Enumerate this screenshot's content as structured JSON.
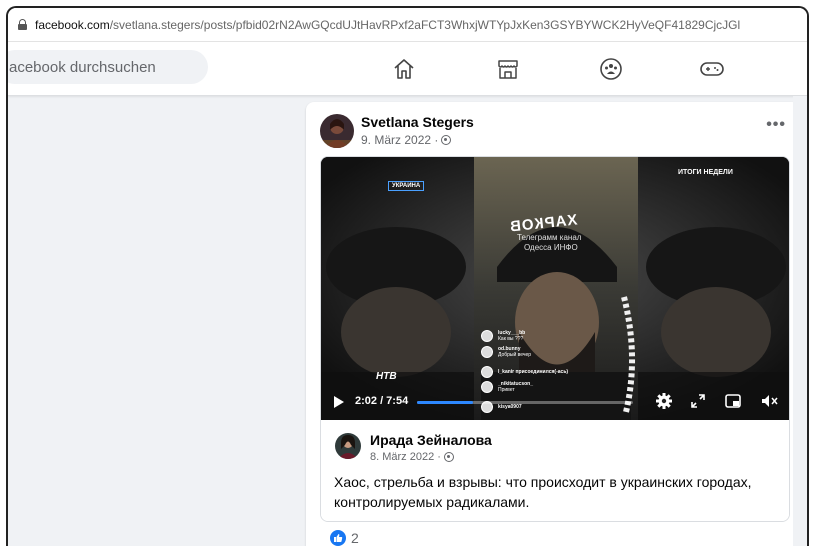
{
  "browser": {
    "url_domain": "facebook.com",
    "url_path": "/svetlana.stegers/posts/pfbid02rN2AwGQcdUJtHavRPxf2aFCT3WhxjWTYpJxKen3GSYBYWCK2HyVeQF41829CjcJGl"
  },
  "nav": {
    "search_placeholder": "acebook durchsuchen",
    "icons": [
      "home-icon",
      "marketplace-icon",
      "groups-icon",
      "gaming-icon"
    ]
  },
  "post": {
    "author": "Svetlana Stegers",
    "date": "9. März 2022 ·",
    "more_label": "•••",
    "video": {
      "tag_left": "УКРАИНА",
      "tag_right": "ИТОГИ НЕДЕЛИ",
      "hat_text": "ХАРКОВ",
      "overlay_line1": "Телеграмм канал",
      "overlay_line2": "Одесса ИНФО",
      "channel_logo": "НТВ",
      "time_display": "2:02 / 7:54",
      "progress": 0.26,
      "chat": [
        {
          "user": "lucky___bb",
          "msg": "Как вы ???"
        },
        {
          "user": "od.bunny",
          "msg": "Добрый вечер"
        },
        {
          "user": "l_kanir присоединился(-ась)",
          "msg": ""
        },
        {
          "user": "_nikitatucson_",
          "msg": "Привет"
        },
        {
          "user": "kisya0907",
          "msg": ""
        }
      ]
    },
    "shared": {
      "author": "Ирада Зейналова",
      "date": "8. März 2022 ·",
      "text": "Хаос, стрельба и взрывы: что происходит в украинских городах, контролируемых радикалами."
    },
    "reactions": {
      "count": "2"
    }
  },
  "colors": {
    "accent": "#1877f2",
    "progress": "#2d88ff",
    "background": "#f0f2f5"
  }
}
